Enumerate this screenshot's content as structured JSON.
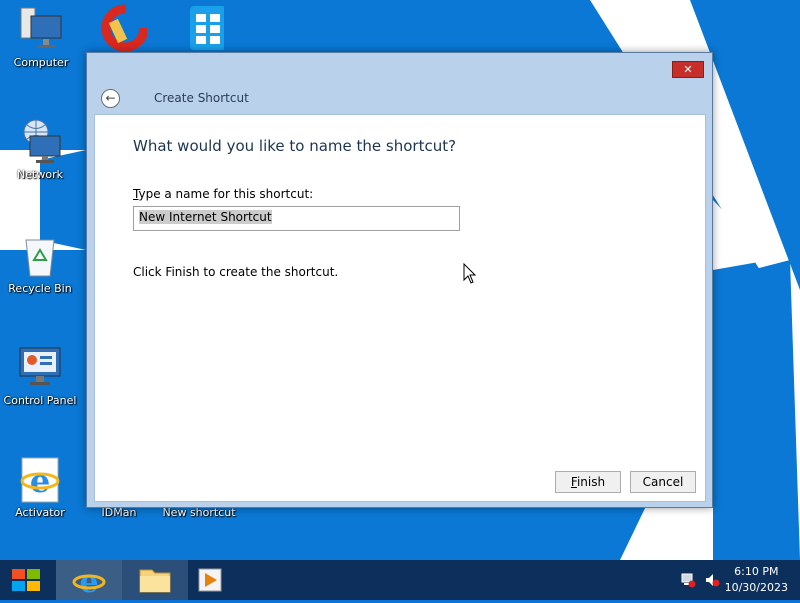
{
  "desktop": {
    "icons": [
      {
        "label": "Computer"
      },
      {
        "label": "Network"
      },
      {
        "label": "Recycle Bin"
      },
      {
        "label": "Control Panel"
      },
      {
        "label": "Activator"
      },
      {
        "label": "IDMan"
      },
      {
        "label": "New shortcut"
      }
    ]
  },
  "dialog": {
    "title": "Create Shortcut",
    "question": "What would you like to name the shortcut?",
    "name_label_prefix": "T",
    "name_label_rest": "ype a name for this shortcut:",
    "name_value": "New Internet Shortcut",
    "instruction": "Click Finish to create the shortcut.",
    "finish_label_prefix": "F",
    "finish_label_rest": "inish",
    "cancel_label": "Cancel",
    "close_glyph": "✕",
    "back_glyph": "←"
  },
  "taskbar": {
    "clock_time": "6:10 PM",
    "clock_date": "10/30/2023"
  },
  "colors": {
    "desktop": "#0078d7",
    "taskbar": "#0c2f5c",
    "dialog_frame": "#b9d1ea",
    "close_button": "#c7302a"
  }
}
